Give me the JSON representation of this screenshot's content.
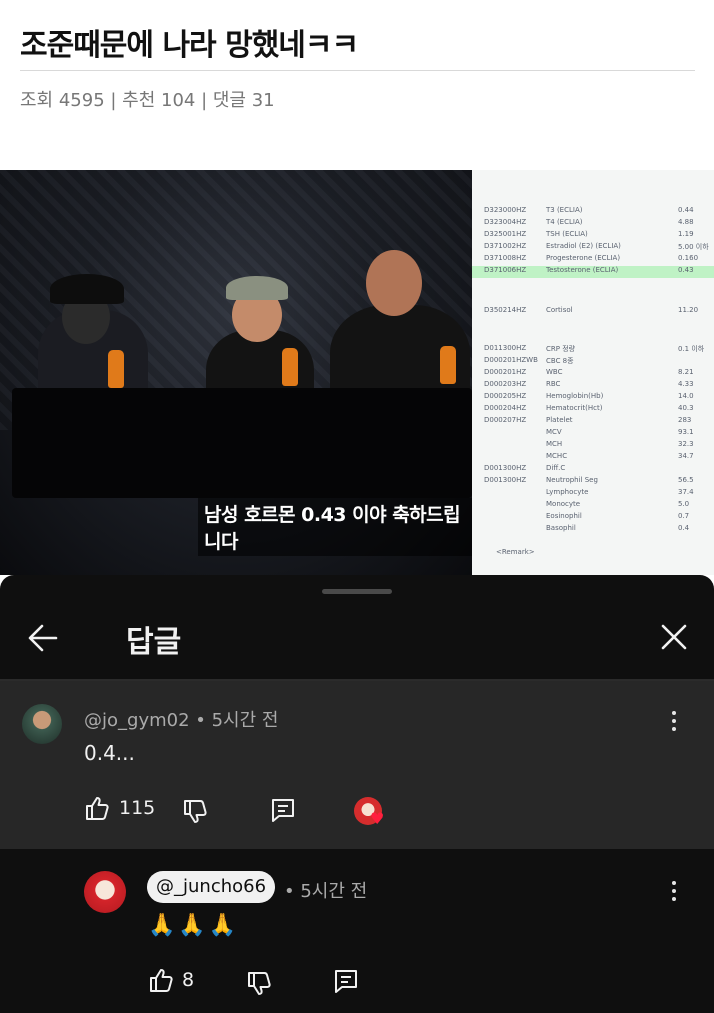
{
  "post": {
    "title": "조준때문에 나라 망했네ㅋㅋ",
    "meta": "조회 4595 | 추천 104 | 댓글 31"
  },
  "video": {
    "subtitle": "남성 호르몬 0.43 이야 축하드립니다",
    "lab_rows": [
      {
        "code": "D323000HZ",
        "name": "T3 (ECLIA)",
        "value": "0.44"
      },
      {
        "code": "D323004HZ",
        "name": "T4 (ECLIA)",
        "value": "4.88"
      },
      {
        "code": "D325001HZ",
        "name": "TSH (ECLIA)",
        "value": "1.19"
      },
      {
        "code": "D371002HZ",
        "name": "Estradiol (E2) (ECLIA)",
        "value": "5.00 이하"
      },
      {
        "code": "D371008HZ",
        "name": "Progesterone (ECLIA)",
        "value": "0.160"
      },
      {
        "code": "D371006HZ",
        "name": "Testosterone (ECLIA)",
        "value": "0.43",
        "highlight": true
      },
      {
        "code": "D350214HZ",
        "name": "Cortisol",
        "value": "11.20"
      },
      {
        "code": "D011300HZ",
        "name": "CRP 정량",
        "value": "0.1 이하"
      },
      {
        "code": "D000201HZWB",
        "name": "CBC 8종",
        "value": ""
      },
      {
        "code": "D000201HZ",
        "name": "WBC",
        "value": "8.21"
      },
      {
        "code": "D000203HZ",
        "name": "RBC",
        "value": "4.33"
      },
      {
        "code": "D000205HZ",
        "name": "Hemoglobin(Hb)",
        "value": "14.0"
      },
      {
        "code": "D000204HZ",
        "name": "Hematocrit(Hct)",
        "value": "40.3"
      },
      {
        "code": "D000207HZ",
        "name": "Platelet",
        "value": "283"
      },
      {
        "code": "",
        "name": "MCV",
        "value": "93.1"
      },
      {
        "code": "",
        "name": "MCH",
        "value": "32.3"
      },
      {
        "code": "",
        "name": "MCHC",
        "value": "34.7"
      },
      {
        "code": "D001300HZ",
        "name": "Diff.C",
        "value": ""
      },
      {
        "code": "D001300HZ",
        "name": "Neutrophil Seg",
        "value": "56.5"
      },
      {
        "code": "",
        "name": "Lymphocyte",
        "value": "37.4"
      },
      {
        "code": "",
        "name": "Monocyte",
        "value": "5.0"
      },
      {
        "code": "",
        "name": "Eosinophil",
        "value": "0.7"
      },
      {
        "code": "",
        "name": "Basophil",
        "value": "0.4"
      }
    ],
    "remark": "<Remark>"
  },
  "panel": {
    "title": "답글",
    "comment1": {
      "author": "@jo_gym02 • 5시간 전",
      "text": "0.4...",
      "likes": "115"
    },
    "comment2": {
      "author": "@_juncho66",
      "time": "• 5시간 전",
      "text": "🙏🙏🙏",
      "likes": "8"
    }
  },
  "colors": {
    "panel_bg": "#0f0f0f",
    "highlight_comment_bg": "#272727",
    "lab_highlight": "#bff2c5",
    "heart": "#ff1f3d"
  }
}
